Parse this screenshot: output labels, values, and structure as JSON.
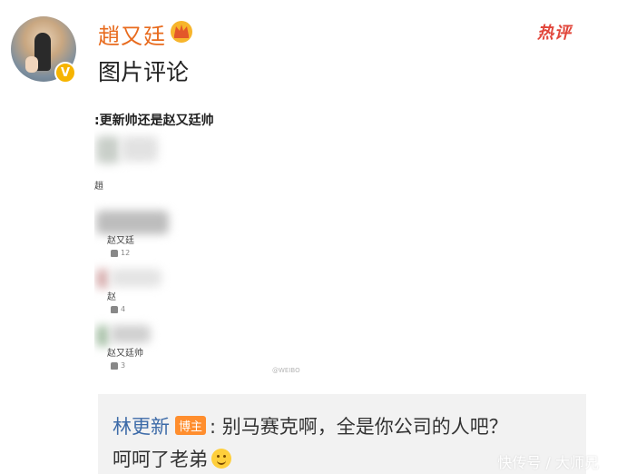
{
  "post": {
    "username": "趙又廷",
    "text": "图片评论",
    "hot_label": "热评",
    "verify_mark": "V"
  },
  "screenshot": {
    "title": ":更新帅还是赵又廷帅",
    "comments": [
      {
        "name": "趙",
        "likes": ""
      },
      {
        "name": "赵又廷",
        "likes": "12"
      },
      {
        "name": "赵",
        "likes": "4"
      },
      {
        "name": "赵又廷帅",
        "likes": "3"
      }
    ],
    "watermark": "@WEIBO"
  },
  "reply": {
    "author": "林更新",
    "badge": "博主",
    "line1": ": 别马赛克啊，全是你公司的人吧？",
    "line2": "呵呵了老弟"
  },
  "watermark": "快传号 / 大师兄"
}
